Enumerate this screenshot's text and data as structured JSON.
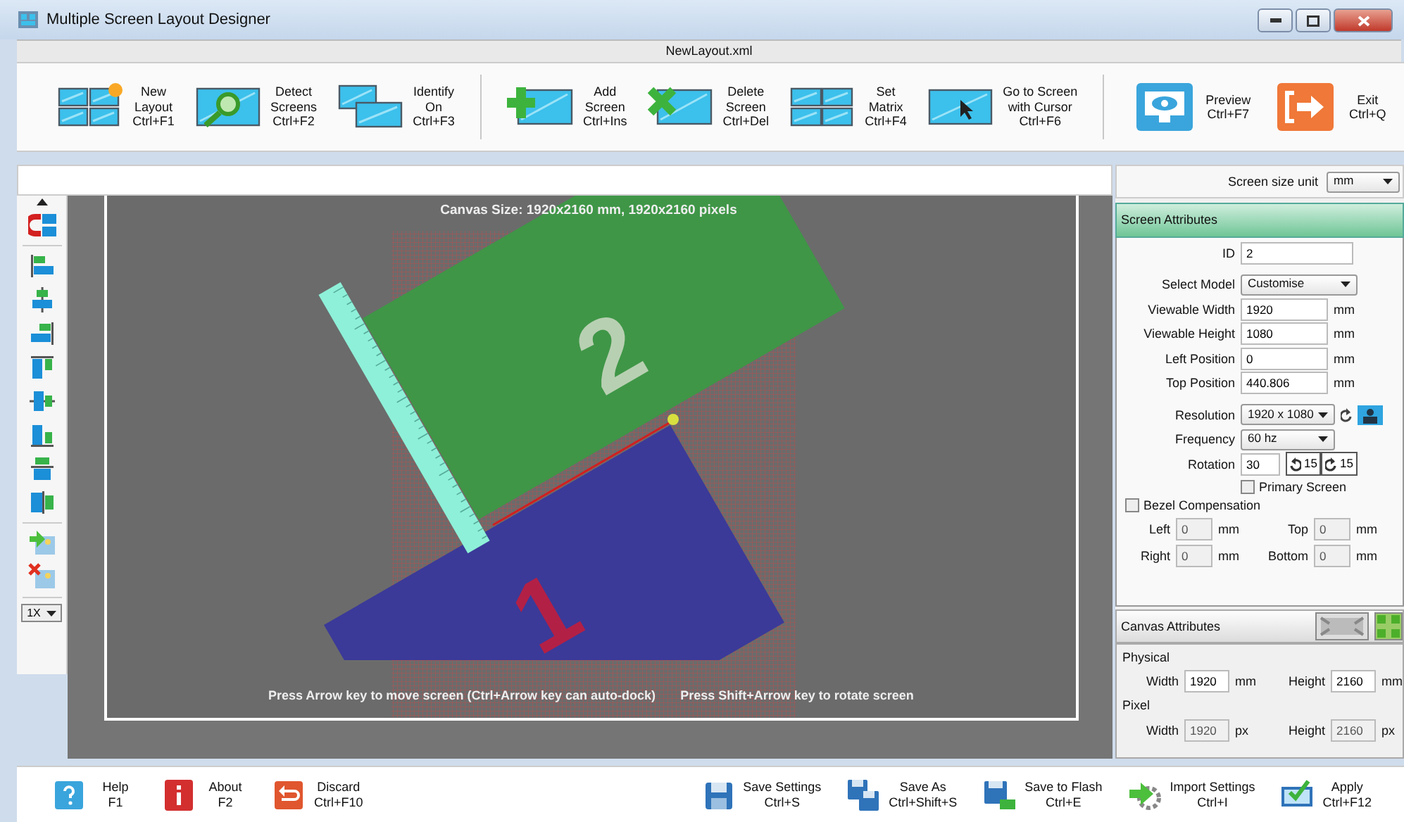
{
  "window": {
    "title": "Multiple Screen Layout Designer",
    "file_name": "NewLayout.xml"
  },
  "toolbar": {
    "groups": [
      [
        {
          "lines": [
            "New",
            "Layout",
            "Ctrl+F1"
          ]
        },
        {
          "lines": [
            "Detect",
            "Screens",
            "Ctrl+F2"
          ]
        },
        {
          "lines": [
            "Identify",
            "On",
            "Ctrl+F3"
          ]
        }
      ],
      [
        {
          "lines": [
            "Add",
            "Screen",
            "Ctrl+Ins"
          ]
        },
        {
          "lines": [
            "Delete",
            "Screen",
            "Ctrl+Del"
          ]
        },
        {
          "lines": [
            "Set",
            "Matrix",
            "Ctrl+F4"
          ]
        },
        {
          "lines": [
            "Go to Screen",
            "with Cursor",
            "Ctrl+F6"
          ]
        }
      ],
      [
        {
          "lines": [
            "Preview",
            "Ctrl+F7"
          ]
        },
        {
          "lines": [
            "Exit",
            "Ctrl+Q"
          ]
        }
      ]
    ]
  },
  "side_tools": {
    "zoom": "1X"
  },
  "canvas": {
    "size_text": "Canvas Size: 1920x2160 mm, 1920x2160 pixels",
    "hints": [
      "Press Arrow key to move screen (Ctrl+Arrow key can auto-dock)",
      "Press Shift+Arrow key to rotate screen"
    ],
    "screens": [
      {
        "id": "1",
        "color": "#3b3a98"
      },
      {
        "id": "2",
        "color": "#3f9647"
      }
    ]
  },
  "screen_size_unit": {
    "label": "Screen size unit",
    "value": "mm"
  },
  "screen_attributes": {
    "title": "Screen Attributes",
    "fields": [
      {
        "kind": "text",
        "label": "ID",
        "value": "2"
      },
      {
        "kind": "select",
        "label": "Select Model",
        "value": "Customise"
      },
      {
        "kind": "text",
        "label": "Viewable Width",
        "value": "1920",
        "unit": "mm"
      },
      {
        "kind": "text",
        "label": "Viewable Height",
        "value": "1080",
        "unit": "mm"
      },
      {
        "kind": "text",
        "label": "Left Position",
        "value": "0",
        "unit": "mm"
      },
      {
        "kind": "text",
        "label": "Top Position",
        "value": "440.806",
        "unit": "mm"
      },
      {
        "kind": "resolution",
        "label": "Resolution",
        "value": "1920 x 1080"
      },
      {
        "kind": "select",
        "label": "Frequency",
        "value": "60 hz"
      },
      {
        "kind": "rotation",
        "label": "Rotation",
        "value": "30",
        "steps": [
          "15",
          "15"
        ]
      }
    ],
    "primary_screen": {
      "label": "Primary Screen",
      "checked": false
    },
    "bezel": {
      "label": "Bezel Compensation",
      "checked": false,
      "fields": [
        {
          "label": "Left",
          "value": "0",
          "unit": "mm",
          "disabled": true
        },
        {
          "label": "Top",
          "value": "0",
          "unit": "mm",
          "disabled": true
        },
        {
          "label": "Right",
          "value": "0",
          "unit": "mm",
          "disabled": true
        },
        {
          "label": "Bottom",
          "value": "0",
          "unit": "mm",
          "disabled": true
        }
      ]
    }
  },
  "canvas_attributes": {
    "title": "Canvas Attributes",
    "sections": [
      {
        "title": "Physical",
        "fields": [
          {
            "label": "Width",
            "value": "1920",
            "unit": "mm",
            "disabled": false
          },
          {
            "label": "Height",
            "value": "2160",
            "unit": "mm",
            "disabled": false
          }
        ]
      },
      {
        "title": "Pixel",
        "fields": [
          {
            "label": "Width",
            "value": "1920",
            "unit": "px",
            "disabled": true
          },
          {
            "label": "Height",
            "value": "2160",
            "unit": "px",
            "disabled": true
          }
        ]
      }
    ]
  },
  "bottom_bar": {
    "left": [
      {
        "lines": [
          "Help",
          "F1"
        ]
      },
      {
        "lines": [
          "About",
          "F2"
        ]
      },
      {
        "lines": [
          "Discard",
          "Ctrl+F10"
        ]
      }
    ],
    "right": [
      {
        "lines": [
          "Save Settings",
          "Ctrl+S"
        ]
      },
      {
        "lines": [
          "Save As",
          "Ctrl+Shift+S"
        ]
      },
      {
        "lines": [
          "Save to Flash",
          "Ctrl+E"
        ]
      },
      {
        "lines": [
          "Import Settings",
          "Ctrl+I"
        ]
      },
      {
        "lines": [
          "Apply",
          "Ctrl+F12"
        ]
      }
    ]
  }
}
